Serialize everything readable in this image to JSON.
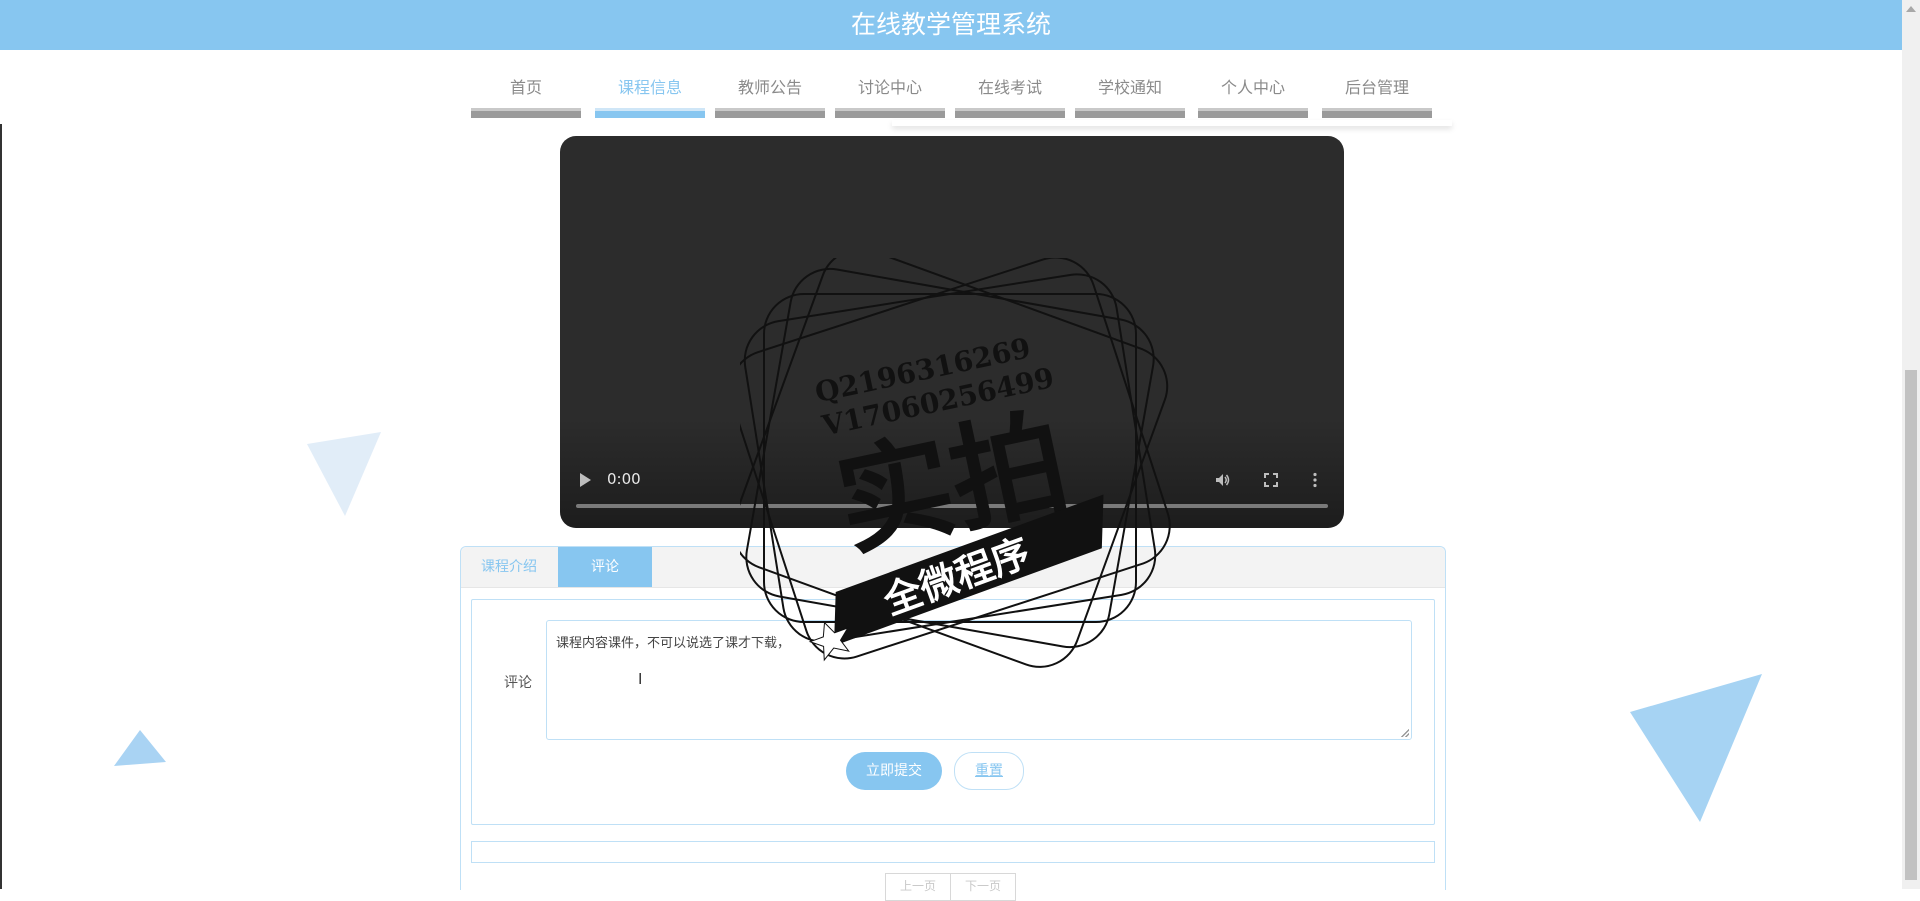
{
  "header": {
    "title": "在线教学管理系统"
  },
  "nav": {
    "items": [
      {
        "label": "首页",
        "active": false
      },
      {
        "label": "课程信息",
        "active": true
      },
      {
        "label": "教师公告",
        "active": false
      },
      {
        "label": "讨论中心",
        "active": false
      },
      {
        "label": "在线考试",
        "active": false
      },
      {
        "label": "学校通知",
        "active": false
      },
      {
        "label": "个人中心",
        "active": false
      },
      {
        "label": "后台管理",
        "active": false
      }
    ]
  },
  "video": {
    "time": "0:00",
    "icons": [
      "play-icon",
      "volume-icon",
      "fullscreen-icon",
      "more-icon"
    ]
  },
  "tabs": {
    "intro": "课程介绍",
    "comment": "评论"
  },
  "form": {
    "label": "评论",
    "value": "课程内容课件，不可以说选了课才下载，",
    "submit": "立即提交",
    "reset": "重置"
  },
  "pager": {
    "prev": "上一页",
    "next": "下一页"
  },
  "watermark": {
    "contact_q": "Q2196316269",
    "contact_v": "V17060256499",
    "big": "实拍",
    "banner": "全微程序"
  },
  "colors": {
    "accent": "#87c6f0",
    "header_bg": "#87c6f0",
    "video_bg": "#2c2c2c"
  }
}
